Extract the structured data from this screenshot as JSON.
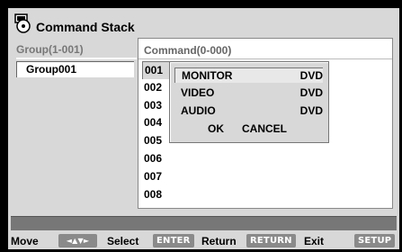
{
  "title": "Command Stack",
  "group": {
    "header": "Group(1-001)",
    "items": [
      "Group001"
    ]
  },
  "command": {
    "header": "Command(0-000)",
    "numbers": [
      "001",
      "002",
      "003",
      "004",
      "005",
      "006",
      "007",
      "008"
    ]
  },
  "popup": {
    "rows": [
      {
        "label": "MONITOR",
        "value": "DVD"
      },
      {
        "label": "VIDEO",
        "value": "DVD"
      },
      {
        "label": "AUDIO",
        "value": "DVD"
      }
    ],
    "ok_label": "OK",
    "cancel_label": "CANCEL"
  },
  "footer": {
    "move_label": "Move",
    "move_key": "◄▲▼►",
    "select_label": "Select",
    "select_key": "ENTER",
    "return_label": "Return",
    "return_key": "RETURN",
    "exit_label": "Exit",
    "exit_key": "SETUP"
  },
  "icons": {
    "title_icon": "disc-tray-icon",
    "move_icon": "arrow-pad-icon"
  }
}
